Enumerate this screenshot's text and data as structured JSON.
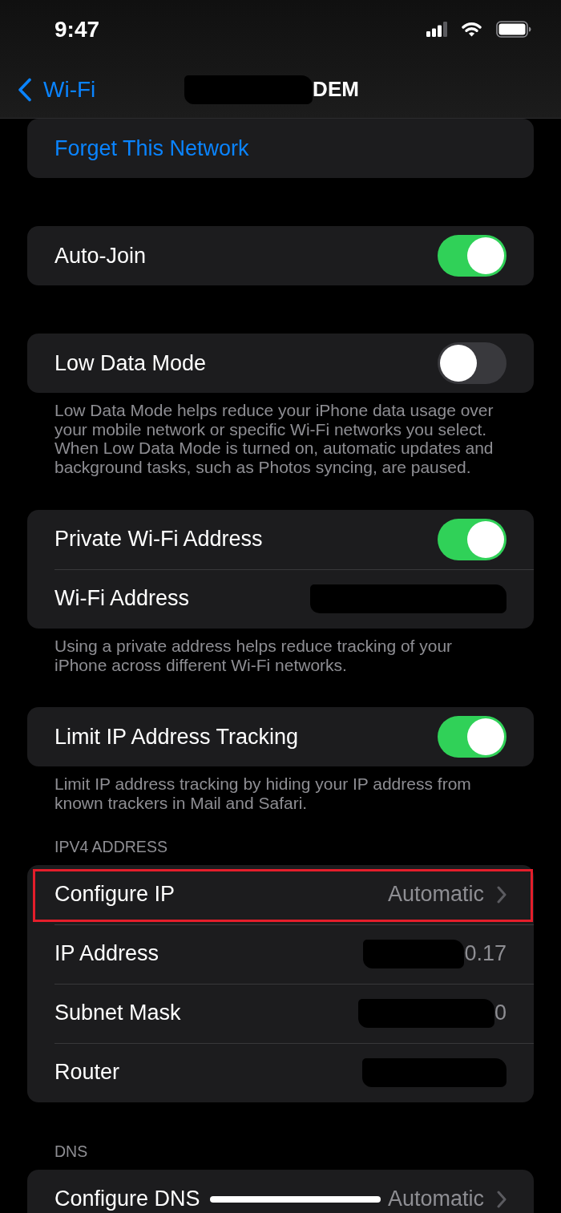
{
  "status_bar": {
    "time": "9:47"
  },
  "nav": {
    "back_label": "Wi-Fi",
    "title": "DEM",
    "title_redacted": true
  },
  "groups": [
    {
      "rows": [
        {
          "kind": "action",
          "label": "Forget This Network",
          "highlighted": false
        }
      ]
    },
    {
      "rows": [
        {
          "kind": "toggle",
          "label": "Auto-Join",
          "on": true,
          "highlighted": false
        }
      ]
    },
    {
      "rows": [
        {
          "kind": "toggle",
          "label": "Low Data Mode",
          "on": false,
          "highlighted": false
        }
      ],
      "footer": "Low Data Mode helps reduce your iPhone data usage over your mobile network or specific Wi-Fi networks you select. When Low Data Mode is turned on, automatic updates and background tasks, such as Photos syncing, are paused."
    },
    {
      "rows": [
        {
          "kind": "toggle",
          "label": "Private Wi-Fi Address",
          "on": true,
          "highlighted": false
        },
        {
          "kind": "value",
          "label": "Wi-Fi Address",
          "redacted": true,
          "highlighted": false
        }
      ],
      "footer": "Using a private address helps reduce tracking of your iPhone across different Wi-Fi networks."
    },
    {
      "rows": [
        {
          "kind": "toggle",
          "label": "Limit IP Address Tracking",
          "on": true,
          "highlighted": false
        }
      ],
      "footer": "Limit IP address tracking by hiding your IP address from known trackers in Mail and Safari."
    },
    {
      "header": "IPV4 ADDRESS",
      "rows": [
        {
          "kind": "disclosure",
          "label": "Configure IP",
          "value": "Automatic",
          "highlighted": true
        },
        {
          "kind": "value",
          "label": "IP Address",
          "value": "0.17",
          "redacted": true,
          "highlighted": false
        },
        {
          "kind": "value",
          "label": "Subnet Mask",
          "value": "0",
          "redacted": true,
          "highlighted": false
        },
        {
          "kind": "value",
          "label": "Router",
          "redacted": true,
          "highlighted": false
        }
      ]
    },
    {
      "header": "DNS",
      "rows": [
        {
          "kind": "disclosure",
          "label": "Configure DNS",
          "value": "Automatic",
          "highlighted": false
        }
      ]
    }
  ]
}
